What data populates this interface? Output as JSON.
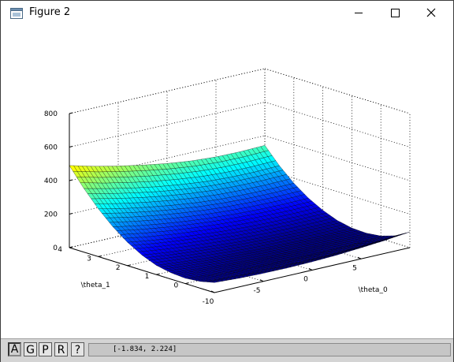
{
  "window": {
    "title": "Figure 2",
    "icons": {
      "app": "figure-window-icon",
      "minimize": "minimize-icon",
      "maximize": "maximize-icon",
      "close": "close-icon"
    }
  },
  "toolbar": {
    "buttons": [
      {
        "label": "A"
      },
      {
        "label": "G"
      },
      {
        "label": "P"
      },
      {
        "label": "R"
      },
      {
        "label": "?"
      }
    ],
    "coordinates": "[-1.834, 2.224]"
  },
  "chart_data": {
    "type": "surface",
    "colormap": "jet",
    "grid": true,
    "box": true,
    "xlabel": "\\theta_0",
    "ylabel": "\\theta_1",
    "zlabel": "",
    "xlim": [
      -10,
      10
    ],
    "ylim": [
      -1,
      4
    ],
    "zlim": [
      0,
      800
    ],
    "xticks": [
      -10,
      -5,
      0,
      5
    ],
    "yticks": [
      0,
      1,
      2,
      3,
      4
    ],
    "zticks": [
      0,
      200,
      400,
      600,
      800
    ],
    "x": [
      -10,
      -7.5,
      -5,
      -2.5,
      0,
      2.5,
      5,
      7.5,
      10
    ],
    "y": [
      -1,
      -0.5,
      0,
      0.5,
      1,
      1.5,
      2,
      2.5,
      3,
      3.5,
      4
    ],
    "z": [
      [
        60,
        40,
        32,
        38,
        55,
        90,
        140,
        205,
        285,
        380,
        490
      ],
      [
        52,
        32,
        22,
        26,
        42,
        72,
        118,
        178,
        254,
        346,
        452
      ],
      [
        48,
        26,
        14,
        16,
        30,
        58,
        100,
        156,
        228,
        316,
        420
      ],
      [
        47,
        22,
        8,
        8,
        20,
        46,
        86,
        138,
        206,
        290,
        392
      ],
      [
        50,
        20,
        4,
        2,
        12,
        36,
        74,
        124,
        188,
        270,
        368
      ],
      [
        56,
        22,
        2,
        0,
        8,
        30,
        66,
        114,
        176,
        254,
        350
      ],
      [
        66,
        26,
        4,
        0,
        6,
        26,
        62,
        108,
        170,
        246,
        340
      ],
      [
        78,
        34,
        8,
        2,
        6,
        26,
        60,
        106,
        168,
        244,
        338
      ],
      [
        94,
        44,
        16,
        6,
        10,
        28,
        62,
        108,
        170,
        248,
        342
      ]
    ]
  }
}
